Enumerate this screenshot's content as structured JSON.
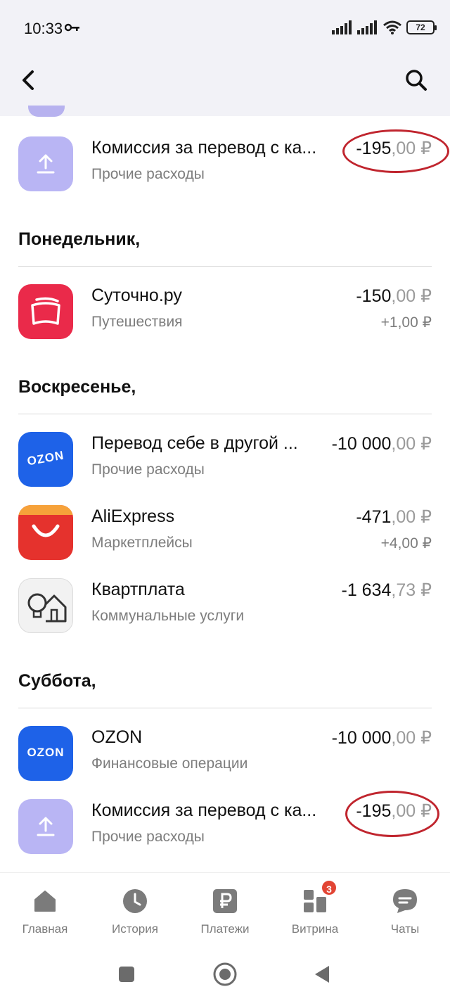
{
  "status": {
    "time": "10:33",
    "battery": "72"
  },
  "transactions_top": [
    {
      "title": "Комиссия за перевод с ка...",
      "category": "Прочие расходы",
      "amount_int": "-195",
      "amount_dec": ",00 ₽"
    }
  ],
  "days": [
    {
      "header": "Понедельник,",
      "items": [
        {
          "title": "Суточно.ру",
          "category": "Путешествия",
          "amount_int": "-150",
          "amount_dec": ",00 ₽",
          "bonus": "+1,00 ₽",
          "icon": "pillow-icon"
        }
      ]
    },
    {
      "header": "Воскресенье,",
      "items": [
        {
          "title": "Перевод себе в другой ...",
          "category": "Прочие расходы",
          "amount_int": "-10 000",
          "amount_dec": ",00 ₽",
          "icon": "ozon-logo-icon",
          "icon_text": "OZON"
        },
        {
          "title": "AliExpress",
          "category": "Маркетплейсы",
          "amount_int": "-471",
          "amount_dec": ",00 ₽",
          "bonus": "+4,00 ₽",
          "icon": "aliexpress-icon"
        },
        {
          "title": "Квартплата",
          "category": "Коммунальные услуги",
          "amount_int": "-1 634",
          "amount_dec": ",73 ₽",
          "icon": "house-bulb-icon"
        }
      ]
    },
    {
      "header": "Суббота,",
      "items": [
        {
          "title": "OZON",
          "category": "Финансовые операции",
          "amount_int": "-10 000",
          "amount_dec": ",00 ₽",
          "icon": "ozon-logo-icon",
          "icon_text": "OZON"
        },
        {
          "title": "Комиссия за перевод с ка...",
          "category": "Прочие расходы",
          "amount_int": "-195",
          "amount_dec": ",00 ₽",
          "icon": "upload-icon"
        }
      ]
    }
  ],
  "tabs": [
    {
      "label": "Главная",
      "icon": "home-icon"
    },
    {
      "label": "История",
      "icon": "clock-icon"
    },
    {
      "label": "Платежи",
      "icon": "ruble-icon"
    },
    {
      "label": "Витрина",
      "icon": "showcase-icon",
      "badge": "3"
    },
    {
      "label": "Чаты",
      "icon": "chat-icon"
    }
  ],
  "colors": {
    "accent_circle": "#c0252e",
    "ozon": "#1e62e8",
    "sutochno": "#ea2a4a",
    "ali": "#e5322d",
    "upload": "#b9b5f4"
  }
}
